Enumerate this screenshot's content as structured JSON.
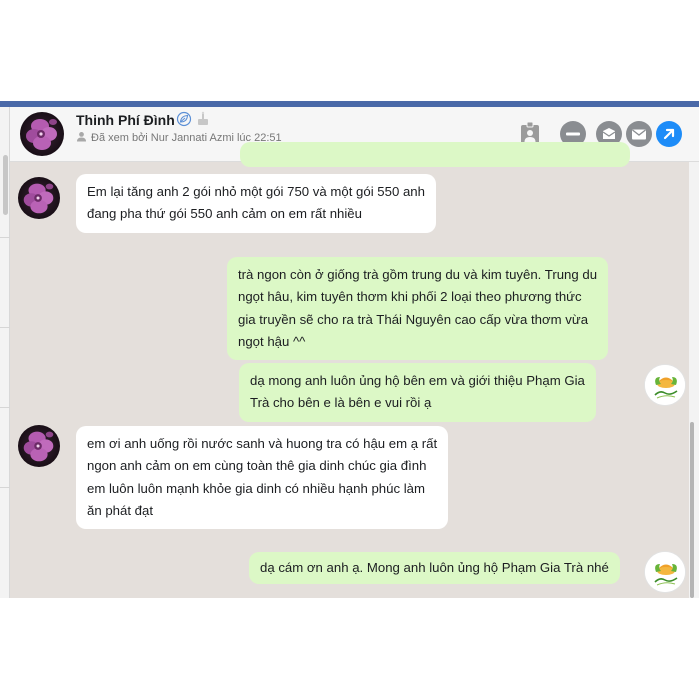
{
  "contact": {
    "name": "Thinh Phí Đình",
    "seen_text": "Đã xem bởi Nur Jannati Azmi lúc 22:51"
  },
  "header_icons": [
    "verified-leaf-icon",
    "birthday-cake-icon",
    "contact-card-icon",
    "minimize-icon",
    "mailbox-icon",
    "email-icon",
    "open-external-icon"
  ],
  "messages": [
    {
      "direction": "incoming",
      "lines": [
        "Em lại tăng anh 2 gói nhỏ một gói 750 và một gói 550 anh",
        "đang pha thứ gói 550 anh cảm on em rất nhiều"
      ]
    },
    {
      "direction": "outgoing",
      "lines": [
        "trà ngon còn ở giống trà gồm trung du và kim tuyên. Trung du",
        "ngọt hâu, kim tuyên thơm khi phối 2 loại theo phương thức",
        "gia truyền sẽ cho ra trà Thái Nguyên cao cấp vừa thơm vừa",
        "ngọt hậu ^^"
      ]
    },
    {
      "direction": "outgoing",
      "lines": [
        "dạ mong anh luôn ủng hộ bên em và giới thiệu Phạm Gia",
        "Trà cho bên e là bên e vui rồi ạ"
      ]
    },
    {
      "direction": "incoming",
      "lines": [
        "em ơi anh uống rồi nước sanh và huong tra có hậu em ạ rất",
        "ngon anh cảm on em cùng toàn thê gia dinh chúc gia đình",
        "em luôn luôn mạnh khỏe gia dinh có nhiều hạnh phúc làm",
        "ăn phát đạt"
      ]
    },
    {
      "direction": "outgoing",
      "lines": [
        "dạ cám ơn anh ạ. Mong anh luôn ủng hộ Phạm Gia Trà nhé"
      ]
    }
  ],
  "colors": {
    "top_bar": "#4a69a8",
    "chat_background": "#e4dfdb",
    "incoming_bubble": "#ffffff",
    "outgoing_bubble": "#dcf8c6",
    "action_blue": "#1d8cf8",
    "action_gray": "#8a8d91"
  }
}
